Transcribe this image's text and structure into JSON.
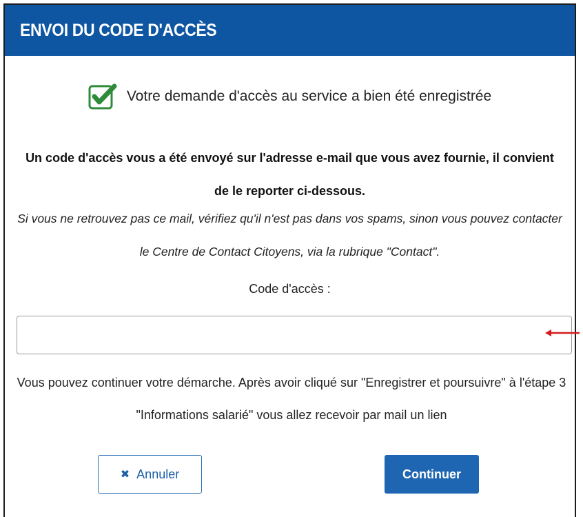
{
  "header": {
    "title": "ENVOI DU CODE D'ACCÈS"
  },
  "success": {
    "icon": "check-square-icon",
    "text": "Votre demande d'accès au service a bien été enregistrée"
  },
  "message": {
    "bold": "Un code d'accès vous a été envoyé sur l'adresse e-mail que vous avez fournie, il convient de le reporter ci-dessous.",
    "italic": "Si vous ne retrouvez pas ce mail, vérifiez qu'il n'est pas dans vos spams, sinon vous pouvez contacter le Centre de Contact Citoyens, via la rubrique \"Contact\"."
  },
  "code_field": {
    "label": "Code d'accès :",
    "value": ""
  },
  "info": {
    "text": "Vous pouvez continuer votre démarche. Après avoir cliqué sur \"Enregistrer et poursuivre\" à l'étape 3 \"Informations salarié\" vous allez recevoir par mail un lien"
  },
  "buttons": {
    "cancel_label": "Annuler",
    "cancel_icon": "close-icon",
    "continue_label": "Continuer"
  },
  "colors": {
    "header_bg": "#0f56a2",
    "primary": "#1f66b2",
    "check_green": "#2e8b3a",
    "annotation_arrow": "#d61a1a"
  }
}
